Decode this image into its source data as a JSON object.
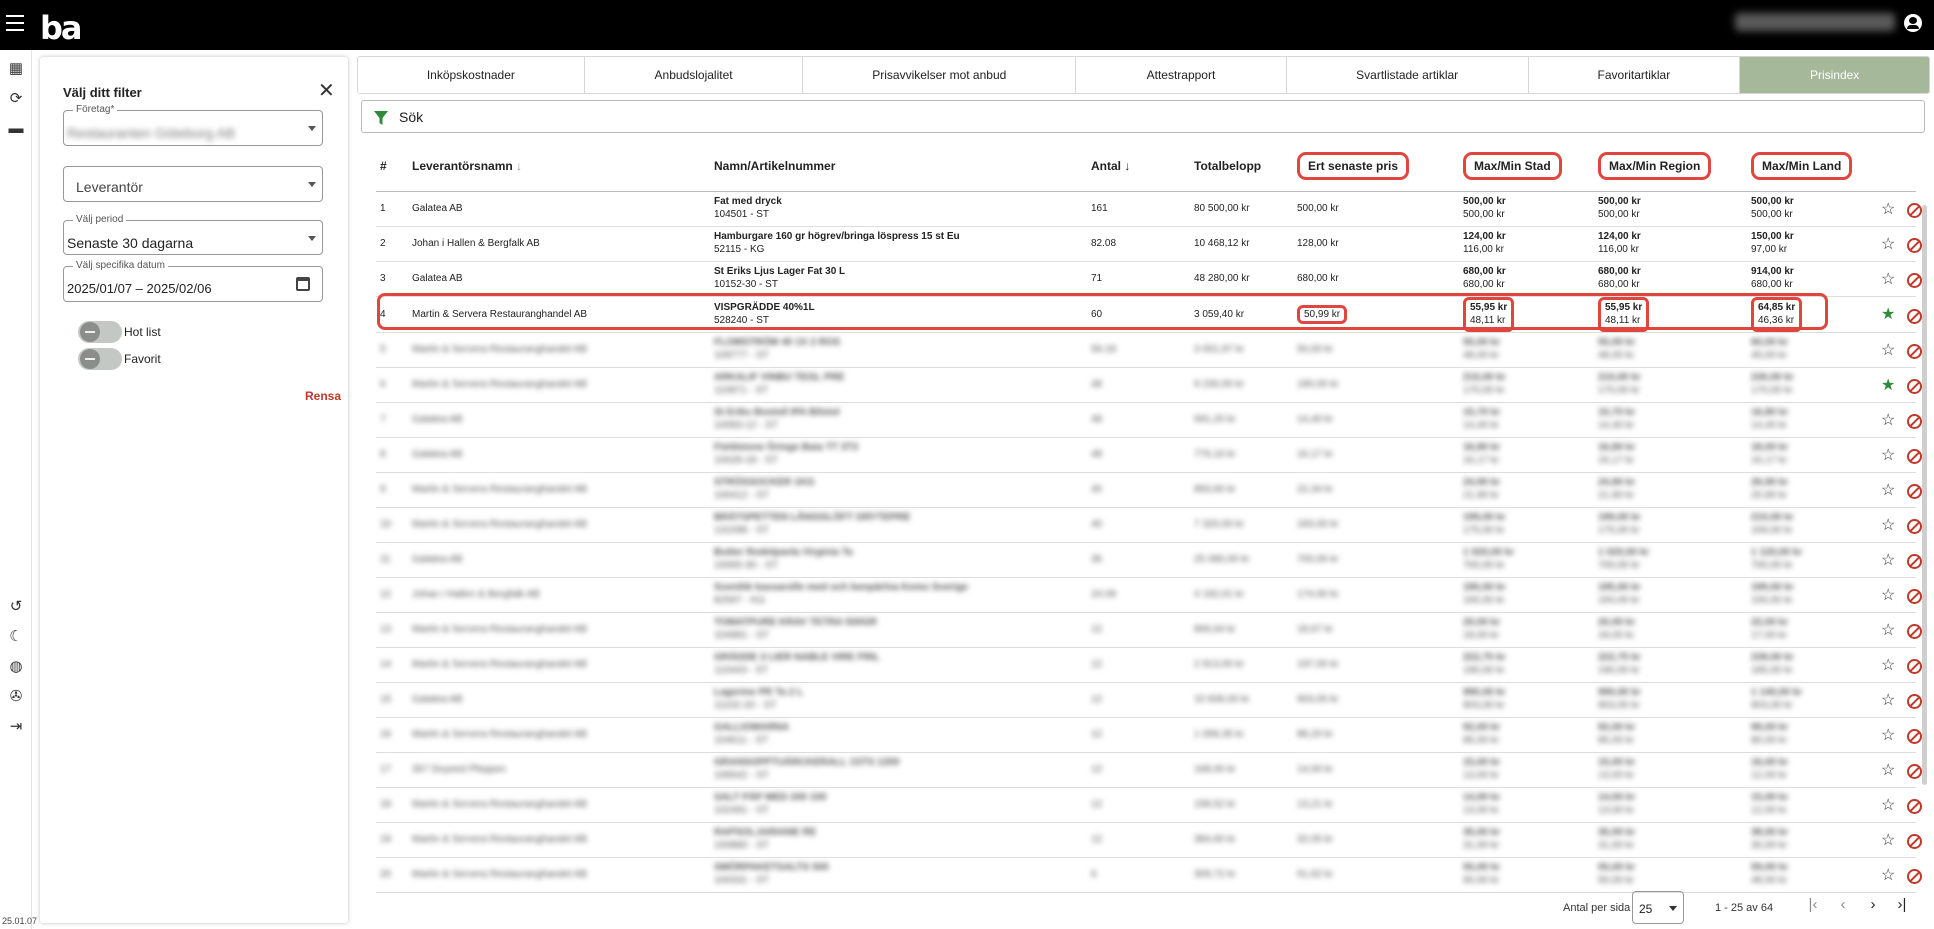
{
  "app": {
    "logo": "ba",
    "version": "25.01.07"
  },
  "rail_icons": [
    "dashboard-icon",
    "sync-icon",
    "store-icon",
    "history-icon",
    "dark-mode-icon",
    "globe-icon",
    "support-icon",
    "logout-icon"
  ],
  "filter": {
    "title": "Välj ditt filter",
    "foretag_label": "Företag*",
    "foretag_value": "Restauranten Göteborg AB",
    "leverantor_placeholder": "Leverantör",
    "period_label": "Välj period",
    "period_value": "Senaste 30 dagarna",
    "datum_label": "Välj specifika datum",
    "datum_value": "2025/01/07 – 2025/02/06",
    "toggle_hotlist": "Hot list",
    "toggle_favorit": "Favorit",
    "clear": "Rensa"
  },
  "tabs": [
    {
      "label": "Inköpskostnader"
    },
    {
      "label": "Anbudslojalitet"
    },
    {
      "label": "Prisavvikelser mot anbud"
    },
    {
      "label": "Attestrapport"
    },
    {
      "label": "Svartlistade artiklar"
    },
    {
      "label": "Favoritartiklar"
    },
    {
      "label": "Prisindex"
    }
  ],
  "search": {
    "label": "Sök"
  },
  "columns": {
    "num": "#",
    "supplier": "Leverantörsnamn",
    "article": "Namn/Artikelnummer",
    "qty": "Antal",
    "total": "Totalbelopp",
    "last_price": "Ert senaste pris",
    "city": "Max/Min Stad",
    "region": "Max/Min Region",
    "country": "Max/Min Land"
  },
  "rows": [
    {
      "n": "1",
      "supplier": "Galatea AB",
      "name": "Fat med dryck",
      "art": "104501 - ST",
      "qty": "161",
      "total": "80 500,00 kr",
      "price": "500,00 kr",
      "city_max": "500,00 kr",
      "city_min": "500,00 kr",
      "reg_max": "500,00 kr",
      "reg_min": "500,00 kr",
      "land_max": "500,00 kr",
      "land_min": "500,00 kr",
      "fav": false
    },
    {
      "n": "2",
      "supplier": "Johan i Hallen & Bergfalk AB",
      "name": "Hamburgare 160 gr högrev/bringa löspress 15 st Eu",
      "art": "52115 - KG",
      "qty": "82.08",
      "total": "10 468,12 kr",
      "price": "128,00 kr",
      "city_max": "124,00 kr",
      "city_min": "116,00 kr",
      "reg_max": "124,00 kr",
      "reg_min": "116,00 kr",
      "land_max": "150,00 kr",
      "land_min": "97,00 kr",
      "fav": false
    },
    {
      "n": "3",
      "supplier": "Galatea AB",
      "name": "St Eriks Ljus Lager Fat 30 L",
      "art": "10152-30 - ST",
      "qty": "71",
      "total": "48 280,00 kr",
      "price": "680,00 kr",
      "city_max": "680,00 kr",
      "city_min": "680,00 kr",
      "reg_max": "680,00 kr",
      "reg_min": "680,00 kr",
      "land_max": "914,00 kr",
      "land_min": "680,00 kr",
      "fav": false
    },
    {
      "n": "4",
      "supplier": "Martin & Servera Restauranghandel AB",
      "name": "VISPGRÄDDE 40%1L",
      "art": "528240 - ST",
      "qty": "60",
      "total": "3 059,40 kr",
      "price": "50,99 kr",
      "city_max": "55,95 kr",
      "city_min": "48,11 kr",
      "reg_max": "55,95 kr",
      "reg_min": "48,11 kr",
      "land_max": "64,85 kr",
      "land_min": "46,36 kr",
      "fav": true
    },
    {
      "n": "5",
      "supplier": "Martin & Servera Restauranghandel AB",
      "name": "FLOMSTRÖM 40 1X 2 ROS",
      "art": "109777 - ST",
      "qty": "59.18",
      "total": "3 001,97 kr",
      "price": "50,00 kr",
      "city_max": "55,00 kr",
      "city_min": "48,00 kr",
      "reg_max": "55,00 kr",
      "reg_min": "48,00 kr",
      "land_max": "60,00 kr",
      "land_min": "45,00 kr",
      "fav": false
    },
    {
      "n": "6",
      "supplier": "Martin & Servera Restauranghandel AB",
      "name": "ARKALIF VINBU TEGL PRE",
      "art": "110871 - ST",
      "qty": "48",
      "total": "9 230,00 kr",
      "price": "190,00 kr",
      "city_max": "210,00 kr",
      "city_min": "170,00 kr",
      "reg_max": "210,00 kr",
      "reg_min": "170,00 kr",
      "land_max": "230,00 kr",
      "land_min": "170,00 kr",
      "fav": true
    },
    {
      "n": "7",
      "supplier": "Galatea AB",
      "name": "St Eriks Bostoll IPA Bilstol",
      "art": "10093-12 - ST",
      "qty": "48",
      "total": "691,20 kr",
      "price": "14,40 kr",
      "city_max": "15,70 kr",
      "city_min": "14,40 kr",
      "reg_max": "15,70 kr",
      "reg_min": "14,40 kr",
      "land_max": "16,80 kr",
      "land_min": "14,40 kr",
      "fav": false
    },
    {
      "n": "8",
      "supplier": "Galatea AB",
      "name": "Fieldstone Öringe Baia TT 3T3",
      "art": "10028-18 - ST",
      "qty": "48",
      "total": "776,16 kr",
      "price": "16,17 kr",
      "city_max": "16,80 kr",
      "city_min": "16,17 kr",
      "reg_max": "16,80 kr",
      "reg_min": "16,17 kr",
      "land_max": "18,00 kr",
      "land_min": "16,17 kr",
      "fav": false
    },
    {
      "n": "9",
      "supplier": "Martin & Servera Restauranghandel AB",
      "name": "STRÖSSOCKER 1KG",
      "art": "100412 - ST",
      "qty": "40",
      "total": "893,60 kr",
      "price": "22,34 kr",
      "city_max": "24,90 kr",
      "city_min": "21,90 kr",
      "reg_max": "24,90 kr",
      "reg_min": "21,90 kr",
      "land_max": "26,90 kr",
      "land_min": "20,90 kr",
      "fav": false
    },
    {
      "n": "10",
      "supplier": "Martin & Servera Restauranghandel AB",
      "name": "BRÄTSPETTEN LÅNGGLÖFT GRYTEPRE",
      "art": "131098 - ST",
      "qty": "40",
      "total": "7 320,00 kr",
      "price": "183,00 kr",
      "city_max": "199,00 kr",
      "city_min": "175,00 kr",
      "reg_max": "199,00 kr",
      "reg_min": "175,00 kr",
      "land_max": "210,00 kr",
      "land_min": "169,00 kr",
      "fav": false
    },
    {
      "n": "11",
      "supplier": "Galatea AB",
      "name": "Butter Rodelpavla Virginia Ta",
      "art": "10065-30 - ST",
      "qty": "36",
      "total": "25 080,00 kr",
      "price": "700,00 kr",
      "city_max": "1 020,00 kr",
      "city_min": "700,00 kr",
      "reg_max": "1 020,00 kr",
      "reg_min": "700,00 kr",
      "land_max": "1 120,00 kr",
      "land_min": "700,00 kr",
      "fav": false
    },
    {
      "n": "12",
      "supplier": "Johan i Hallen & Bergfalk AB",
      "name": "Svenlök kassarolle med och benpärlna Kemo Sverige",
      "art": "82597 - KG",
      "qty": "24.09",
      "total": "4 192,01 kr",
      "price": "174,00 kr",
      "city_max": "185,00 kr",
      "city_min": "160,00 kr",
      "reg_max": "185,00 kr",
      "reg_min": "160,00 kr",
      "land_max": "199,00 kr",
      "land_min": "150,00 kr",
      "fav": false
    },
    {
      "n": "13",
      "supplier": "Martin & Servera Restauranghandel AB",
      "name": "TOMATPURE KRAV TETRA 500GR",
      "art": "104981 - ST",
      "qty": "12",
      "total": "806,64 kr",
      "price": "18,67 kr",
      "city_max": "20,00 kr",
      "city_min": "18,00 kr",
      "reg_max": "20,00 kr",
      "reg_min": "18,00 kr",
      "land_max": "22,00 kr",
      "land_min": "17,00 kr",
      "fav": false
    },
    {
      "n": "14",
      "supplier": "Martin & Servera Restauranghandel AB",
      "name": "GRÄDDE 3 LIER NABLE VIRE FRIL",
      "art": "110443 - ST",
      "qty": "12",
      "total": "2 913,00 kr",
      "price": "197,00 kr",
      "city_max": "222,75 kr",
      "city_min": "190,00 kr",
      "reg_max": "222,75 kr",
      "reg_min": "190,00 kr",
      "land_max": "239,00 kr",
      "land_min": "185,00 kr",
      "fav": false
    },
    {
      "n": "15",
      "supplier": "Galatea AB",
      "name": "Lagerine PR Ta 2 L",
      "art": "11102-20 - ST",
      "qty": "12",
      "total": "10 836,00 kr",
      "price": "903,00 kr",
      "city_max": "990,00 kr",
      "city_min": "903,00 kr",
      "reg_max": "990,00 kr",
      "reg_min": "903,00 kr",
      "land_max": "1 140,00 kr",
      "land_min": "903,00 kr",
      "fav": false
    },
    {
      "n": "16",
      "supplier": "Martin & Servera Restauranghandel AB",
      "name": "GALLIOMARNA",
      "art": "104611 - ST",
      "qty": "12",
      "total": "1 058,35 kr",
      "price": "88,20 kr",
      "city_max": "92,00 kr",
      "city_min": "85,00 kr",
      "reg_max": "92,00 kr",
      "reg_min": "85,00 kr",
      "land_max": "99,00 kr",
      "land_min": "80,00 kr",
      "fav": false
    },
    {
      "n": "17",
      "supplier": "357 Doyeed Pfeppen",
      "name": "GRANSOPPTUÄRCKERALL 1STS 1200",
      "art": "106542 - ST",
      "qty": "12",
      "total": "168,00 kr",
      "price": "14,00 kr",
      "city_max": "15,00 kr",
      "city_min": "13,00 kr",
      "reg_max": "15,00 kr",
      "reg_min": "13,00 kr",
      "land_max": "16,00 kr",
      "land_min": "12,00 kr",
      "fav": false
    },
    {
      "n": "18",
      "supplier": "Martin & Servera Restauranghandel AB",
      "name": "SALT PÄP MED 200 100",
      "art": "102491 - ST",
      "qty": "12",
      "total": "158,52 kr",
      "price": "13,21 kr",
      "city_max": "14,00 kr",
      "city_min": "13,00 kr",
      "reg_max": "14,00 kr",
      "reg_min": "13,00 kr",
      "land_max": "15,00 kr",
      "land_min": "12,00 kr",
      "fav": false
    },
    {
      "n": "19",
      "supplier": "Martin & Servera Restauranghandel AB",
      "name": "RAPSOLJARIANE RE",
      "art": "100880 - ST",
      "qty": "12",
      "total": "384,60 kr",
      "price": "32,05 kr",
      "city_max": "35,00 kr",
      "city_min": "31,00 kr",
      "reg_max": "35,00 kr",
      "reg_min": "31,00 kr",
      "land_max": "38,00 kr",
      "land_min": "30,00 kr",
      "fav": false
    },
    {
      "n": "20",
      "supplier": "Martin & Servera Restauranghandel AB",
      "name": "SMÖRPAKETSALTS 500",
      "art": "100331 - ST",
      "qty": "6",
      "total": "309,72 kr",
      "price": "51,62 kr",
      "city_max": "55,00 kr",
      "city_min": "50,00 kr",
      "reg_max": "55,00 kr",
      "reg_min": "50,00 kr",
      "land_max": "59,00 kr",
      "land_min": "48,00 kr",
      "fav": false
    }
  ],
  "pager": {
    "per_page_label": "Antal per sida",
    "per_page": "25",
    "range": "1 - 25 av 64"
  },
  "colors": {
    "accent_tab": "#a5b99a",
    "highlight": "#e0463e",
    "favorite": "#2e8b3a",
    "blacklist": "#c0392b"
  }
}
